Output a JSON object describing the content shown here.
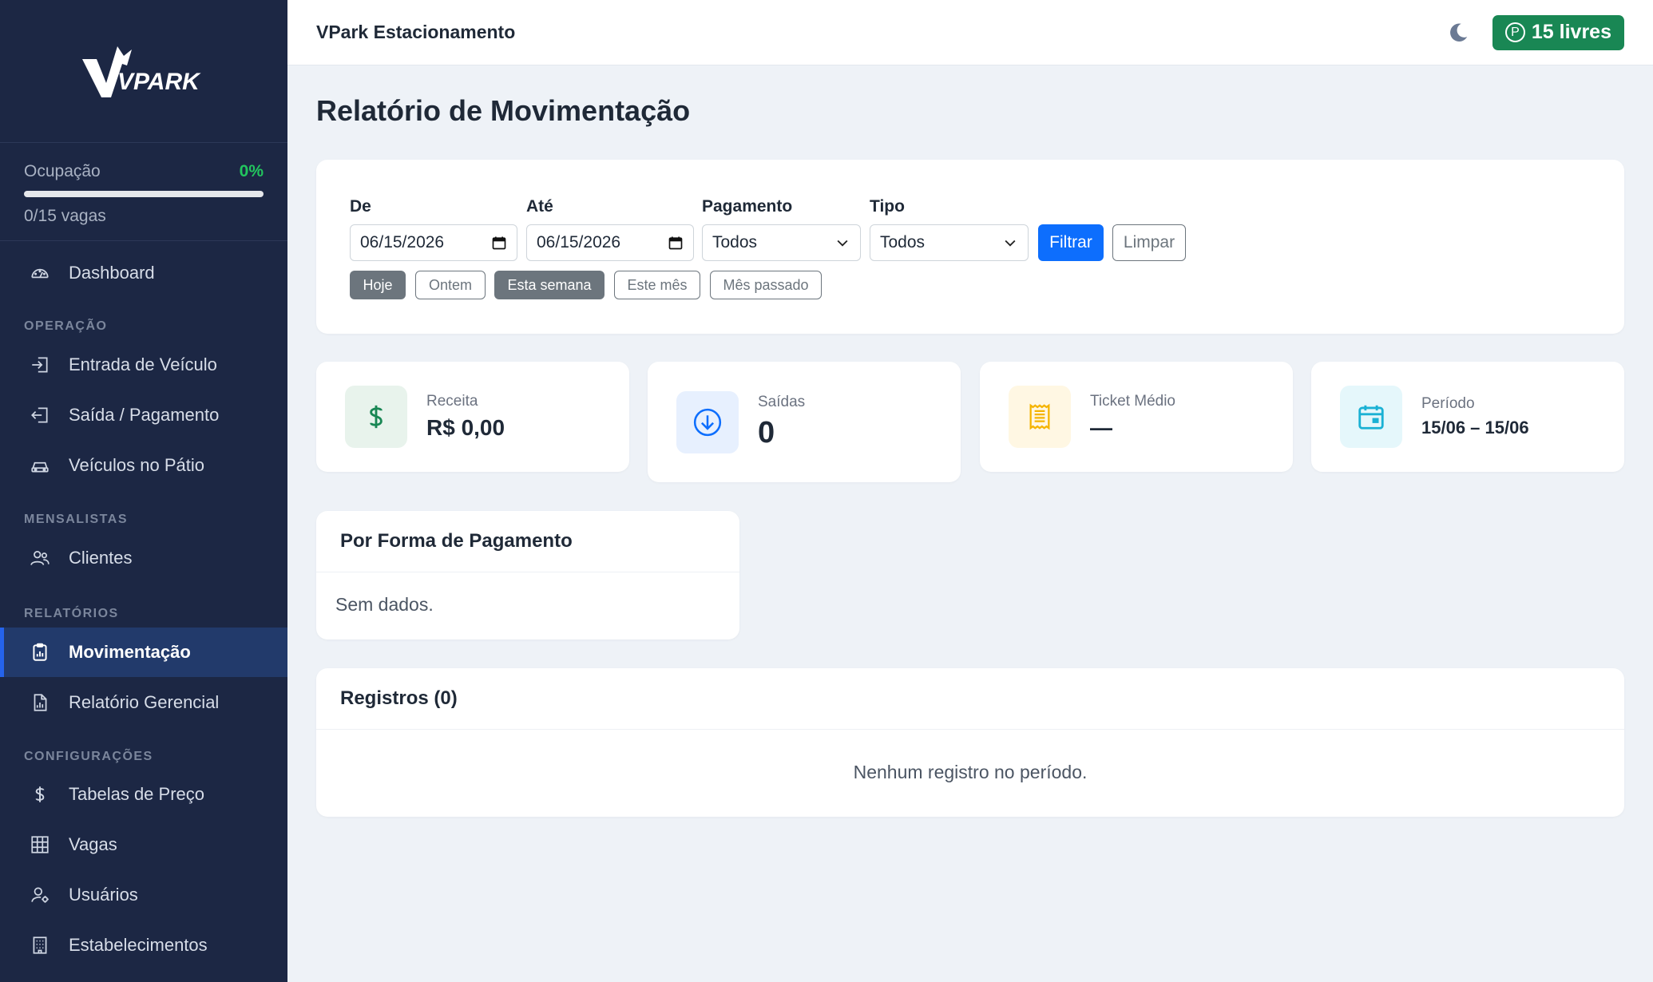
{
  "brand": {
    "logo_text": "VPARK"
  },
  "sidebar": {
    "occupancy": {
      "label": "Ocupação",
      "percent": "0%",
      "fill_fraction": 0.0,
      "sub": "0/15 vagas"
    },
    "items": [
      {
        "label": "Dashboard",
        "icon": "gauge-icon"
      },
      {
        "label": "Entrada de Veículo",
        "icon": "sign-in-icon"
      },
      {
        "label": "Saída / Pagamento",
        "icon": "sign-out-icon"
      },
      {
        "label": "Veículos no Pátio",
        "icon": "car-icon"
      },
      {
        "label": "Clientes",
        "icon": "users-icon"
      },
      {
        "label": "Movimentação",
        "icon": "clipboard-chart-icon",
        "active": true
      },
      {
        "label": "Relatório Gerencial",
        "icon": "file-chart-icon"
      },
      {
        "label": "Tabelas de Preço",
        "icon": "dollar-icon"
      },
      {
        "label": "Vagas",
        "icon": "grid-icon"
      },
      {
        "label": "Usuários",
        "icon": "user-gear-icon"
      },
      {
        "label": "Estabelecimentos",
        "icon": "building-icon"
      }
    ],
    "sections": [
      "OPERAÇÃO",
      "MENSALISTAS",
      "RELATÓRIOS",
      "CONFIGURAÇÕES"
    ]
  },
  "topbar": {
    "title": "VPark Estacionamento",
    "free_spots": "15 livres",
    "p_symbol": "P"
  },
  "page": {
    "title": "Relatório de Movimentação"
  },
  "filters": {
    "from_label": "De",
    "from_value": "06/15/2026",
    "to_label": "Até",
    "to_value": "06/15/2026",
    "payment_label": "Pagamento",
    "payment_value": "Todos",
    "type_label": "Tipo",
    "type_value": "Todos",
    "filter_button": "Filtrar",
    "clear_button": "Limpar",
    "chips": [
      {
        "label": "Hoje",
        "selected": true
      },
      {
        "label": "Ontem",
        "selected": false
      },
      {
        "label": "Esta semana",
        "selected": true
      },
      {
        "label": "Este mês",
        "selected": false
      },
      {
        "label": "Mês passado",
        "selected": false
      }
    ]
  },
  "stats": [
    {
      "label": "Receita",
      "value": "R$ 0,00",
      "icon": "dollar-icon",
      "color": "#198754",
      "bg": "#e8f3ec"
    },
    {
      "label": "Saídas",
      "value": "0",
      "icon": "arrow-down-circle-icon",
      "color": "#0d6efd",
      "bg": "#e7f0fe"
    },
    {
      "label": "Ticket Médio",
      "value": "—",
      "icon": "receipt-icon",
      "color": "#f5b400",
      "bg": "#fff7e3"
    },
    {
      "label": "Período",
      "value": "15/06 – 15/06",
      "icon": "calendar-icon",
      "color": "#1ab1d4",
      "bg": "#e5f7fb"
    }
  ],
  "payment_panel": {
    "title": "Por Forma de Pagamento",
    "empty": "Sem dados."
  },
  "records_panel": {
    "title": "Registros (0)",
    "empty": "Nenhum registro no período."
  }
}
